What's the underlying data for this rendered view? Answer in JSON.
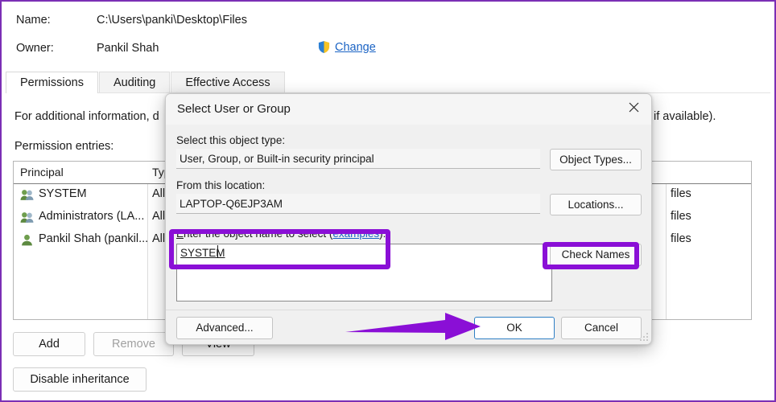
{
  "window": {
    "name_label": "Name:",
    "name_value": "C:\\Users\\panki\\Desktop\\Files",
    "owner_label": "Owner:",
    "owner_value": "Pankil Shah",
    "change_link": "Change",
    "tabs": [
      {
        "label": "Permissions",
        "active": true
      },
      {
        "label": "Auditing",
        "active": false
      },
      {
        "label": "Effective Access",
        "active": false
      }
    ],
    "info_text": "For additional information, d",
    "info_text_right": "if available).",
    "entries_label": "Permission entries:",
    "columns": [
      {
        "label": "Principal"
      },
      {
        "label": "Typ"
      }
    ],
    "rows": [
      {
        "principal": "SYSTEM",
        "type": "Allo",
        "applies_to": "files",
        "icon": "group-icon"
      },
      {
        "principal": "Administrators (LA...",
        "type": "Allo",
        "applies_to": "files",
        "icon": "group-icon"
      },
      {
        "principal": "Pankil Shah (pankil...",
        "type": "Allo",
        "applies_to": "files",
        "icon": "user-icon"
      }
    ],
    "buttons": {
      "add": "Add",
      "remove": "Remove",
      "view": "View",
      "disable_inheritance": "Disable inheritance"
    }
  },
  "dialog": {
    "title": "Select User or Group",
    "close_icon": "close-icon",
    "object_type_label": "Select this object type:",
    "object_type_value": "User, Group, or Built-in security principal",
    "object_types_button": "Object Types...",
    "location_label": "From this location:",
    "location_value": "LAPTOP-Q6EJP3AM",
    "locations_button": "Locations...",
    "object_name_label_pre": "nter the object name to select (",
    "object_name_accel": "E",
    "object_name_examples": "examples",
    "object_name_label_post": "):",
    "object_name_value": "SYSTEM",
    "check_names_button": "Check Names",
    "advanced_button": "Advanced...",
    "ok_button": "OK",
    "cancel_button": "Cancel"
  },
  "annotations": {
    "highlight_color": "#8a0fd6",
    "arrow_color": "#8a0fd6",
    "frame_color": "#7b2fb5"
  }
}
